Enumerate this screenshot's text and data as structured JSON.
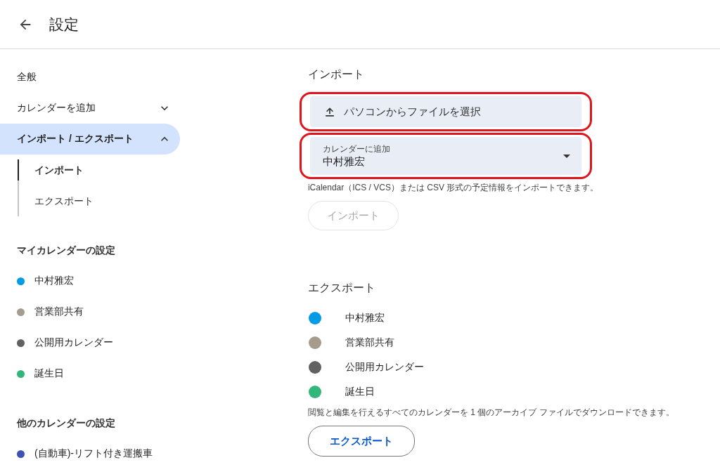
{
  "header": {
    "title": "設定"
  },
  "sidebar": {
    "items": [
      {
        "label": "全般",
        "kind": "link",
        "selected": false
      },
      {
        "label": "カレンダーを追加",
        "kind": "group",
        "expanded": false,
        "selected": false
      },
      {
        "label": "インポート / エクスポート",
        "kind": "group",
        "expanded": true,
        "selected": true,
        "children": [
          {
            "label": "インポート",
            "selected": true
          },
          {
            "label": "エクスポート",
            "selected": false
          }
        ]
      }
    ],
    "sections": [
      {
        "heading": "マイカレンダーの設定",
        "calendars": [
          {
            "name": "中村雅宏",
            "color": "#039be5"
          },
          {
            "name": "営業部共有",
            "color": "#a79b8e"
          },
          {
            "name": "公開用カレンダー",
            "color": "#616161"
          },
          {
            "name": "誕生日",
            "color": "#33b679"
          }
        ]
      },
      {
        "heading": "他のカレンダーの設定",
        "calendars": [
          {
            "name": "(自動車)-リフト付き運搬車",
            "color": "#3f51b5"
          }
        ]
      }
    ]
  },
  "import": {
    "heading": "インポート",
    "file_button": {
      "label": "パソコンからファイルを選択",
      "highlighted": true
    },
    "calendar_select": {
      "label": "カレンダーに追加",
      "value": "中村雅宏",
      "highlighted": true
    },
    "note": "iCalendar（ICS / VCS）または CSV 形式の予定情報をインポートできます。",
    "button": {
      "label": "インポート",
      "disabled": true
    }
  },
  "export": {
    "heading": "エクスポート",
    "calendars": [
      {
        "name": "中村雅宏",
        "color": "#039be5"
      },
      {
        "name": "営業部共有",
        "color": "#a79b8e"
      },
      {
        "name": "公開用カレンダー",
        "color": "#616161"
      },
      {
        "name": "誕生日",
        "color": "#33b679"
      }
    ],
    "note": "閲覧と編集を行えるすべてのカレンダーを 1 個のアーカイブ ファイルでダウンロードできます。",
    "button": {
      "label": "エクスポート",
      "disabled": false
    }
  }
}
